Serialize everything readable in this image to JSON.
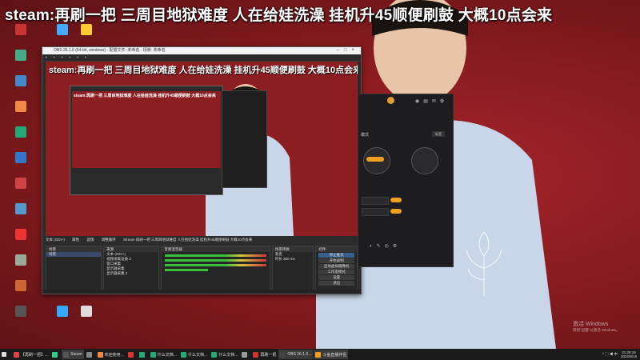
{
  "banner": {
    "text": "steam:再刷一把 三周目地狱难度 人在给娃洗澡 挂机升45顺便刷鼓 大概10点会来"
  },
  "obs": {
    "title": "OBS 26.1.0 (64-bit, windows) - 配置文件: 未命名 - 场景: 未命名",
    "preview_banner": "steam:再刷一把 三周目地狱难度 人在给娃洗澡 挂机升45顺便刷鼓 大概10点会来",
    "nested_banner": "steam:再刷一把 三周目地狱难度 人在给娃洗澡 挂机升45顺便刷鼓 大概10点会来",
    "tabs": [
      "文本 (GDI+)",
      "属性",
      "滤镜",
      "调整顺序",
      "Stream 再刷一把 三周目地狱难度 人在给娃洗澡 挂机升45顺便刷鼓 大概10点会来"
    ],
    "docks": {
      "scenes_header": "场景",
      "scenes": [
        "场景"
      ],
      "sources_header": "来源",
      "sources": [
        "文本 (GDI+)",
        "视频采集设备 2",
        "窗口采集",
        "显示器采集",
        "显示器采集 2"
      ],
      "mixer_header": "音频混音器",
      "transitions_header": "场景转换",
      "transition_value": "渐变",
      "duration_label": "时长",
      "duration_value": "300 ms",
      "controls_header": "控件",
      "controls": [
        "停止推流",
        "开始录制",
        "启动虚拟摄像机",
        "工作室模式",
        "设置",
        "退出"
      ]
    }
  },
  "panel": {
    "mode_label": "模式",
    "tag_label": "标签"
  },
  "watermark": {
    "line1": "激活 Windows",
    "line2": "转到\"设置\"以激活 Windows。"
  },
  "taskbar": {
    "items": [
      {
        "label": "【再刷一把】...",
        "color": "#d44"
      },
      {
        "label": "",
        "color": "#3c8"
      },
      {
        "label": "Steam",
        "color": "#555",
        "active": true
      },
      {
        "label": "",
        "color": "#888"
      },
      {
        "label": "欢迎使用...",
        "color": "#e84"
      },
      {
        "label": "",
        "color": "#d33"
      },
      {
        "label": "",
        "color": "#2a7"
      },
      {
        "label": "什么文档...",
        "color": "#2a7"
      },
      {
        "label": "什么文档...",
        "color": "#2a7"
      },
      {
        "label": "什么文档...",
        "color": "#2a7"
      },
      {
        "label": "",
        "color": "#999"
      },
      {
        "label": "再刷一把",
        "color": "#c33"
      },
      {
        "label": "OBS 26.1.0...",
        "color": "#444",
        "active": true
      },
      {
        "label": "斗鱼直播伴侣",
        "color": "#f0a020",
        "active": true
      }
    ],
    "time": "21:28:16",
    "date": "2022/8/16"
  }
}
